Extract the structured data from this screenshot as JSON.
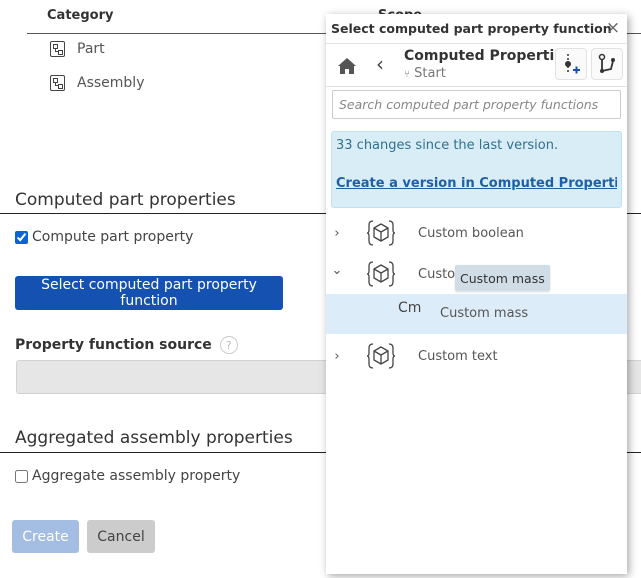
{
  "background_form": {
    "category_header": "Category",
    "scope_header": "Scope",
    "categories": [
      {
        "label": "Part",
        "icon": "tree-structure-icon"
      },
      {
        "label": "Assembly",
        "icon": "tree-structure-icon"
      }
    ],
    "computed_section": {
      "title": "Computed part properties",
      "checkbox_label": "Compute part property",
      "checked": true,
      "select_button": "Select computed part property function",
      "source_label": "Property function source",
      "help_glyph": "?",
      "source_value": ""
    },
    "aggregated_section": {
      "title": "Aggregated assembly properties",
      "checkbox_label": "Aggregate assembly property",
      "checked": false
    },
    "buttons": {
      "create": "Create",
      "cancel": "Cancel"
    }
  },
  "panel": {
    "title": "Select computed part property function",
    "close_glyph": "×",
    "document_name": "Computed Properti...",
    "branch_glyph": "⑂",
    "branch_name": "Start",
    "search_placeholder": "Search computed part property functions",
    "info": {
      "message": "33 changes since the last version.",
      "link": "Create a version in Computed Properties ..."
    },
    "items": [
      {
        "label": "Custom boolean",
        "expanded": false,
        "chevron": "›"
      },
      {
        "label": "Custom mass",
        "label_visible": "Custor",
        "expanded": true,
        "chevron": "⌄",
        "children": [
          {
            "abbrev": "Cm",
            "label": "Custom mass",
            "selected": true
          }
        ]
      },
      {
        "label": "Custom text",
        "expanded": false,
        "chevron": "›"
      }
    ],
    "tooltip": "Custom mass"
  },
  "colors": {
    "primary": "#1451b0",
    "primary_disabled": "#a3bde3",
    "info_bg": "#d9edf7",
    "selected_row": "#dcedf9",
    "link": "#1d5fa8"
  }
}
